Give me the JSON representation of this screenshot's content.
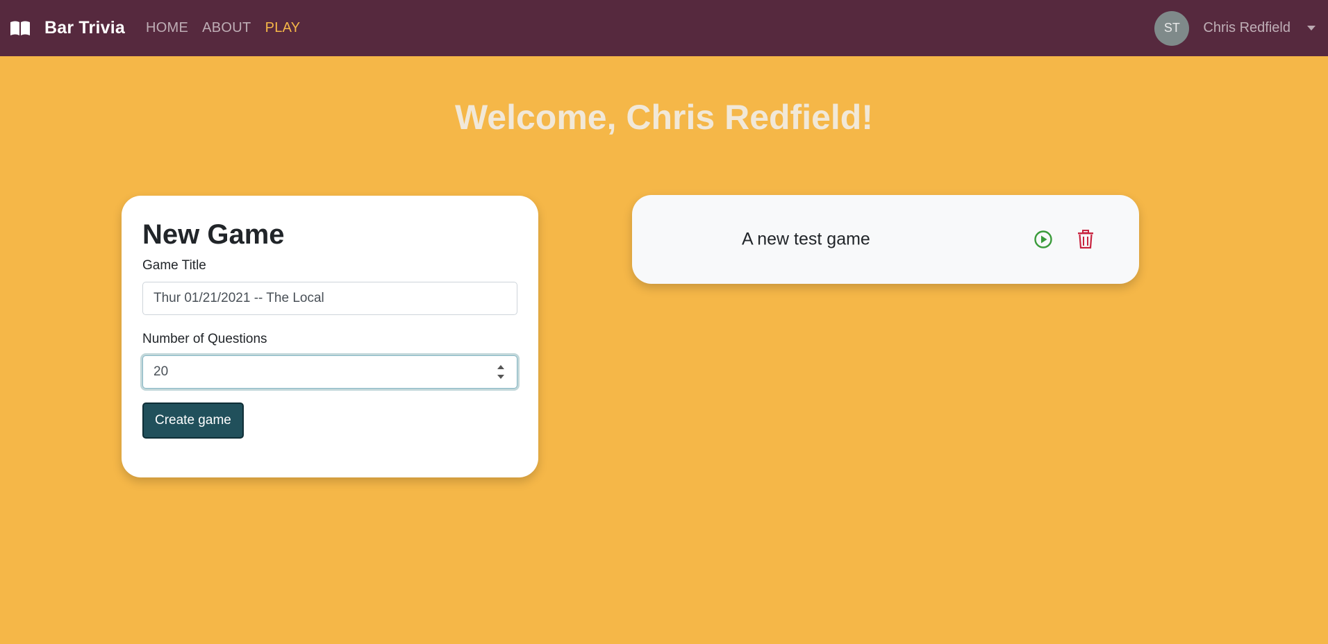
{
  "colors": {
    "page_background": "#f5b748",
    "navbar_background": "#56293e",
    "active_nav": "#f5b748",
    "create_button": "#21505b",
    "play_icon": "#3a9b3a",
    "trash_icon": "#c8233f"
  },
  "navbar": {
    "brand_icon": "book-open-icon",
    "brand": "Bar Trivia",
    "links": [
      {
        "label": "HOME",
        "active": false
      },
      {
        "label": "ABOUT",
        "active": false
      },
      {
        "label": "PLAY",
        "active": true
      }
    ],
    "user": {
      "avatar_initials": "ST",
      "name": "Chris Redfield",
      "dropdown_icon": "caret-down-icon"
    }
  },
  "welcome": "Welcome, Chris Redfield!",
  "new_game": {
    "title": "New Game",
    "game_title_label": "Game Title",
    "game_title_value": "Thur 01/21/2021 -- The Local",
    "num_questions_label": "Number of Questions",
    "num_questions_value": "20",
    "create_button": "Create game"
  },
  "games": [
    {
      "title": "A new test game",
      "play_icon": "play-circle-icon",
      "delete_icon": "trash-icon"
    }
  ]
}
